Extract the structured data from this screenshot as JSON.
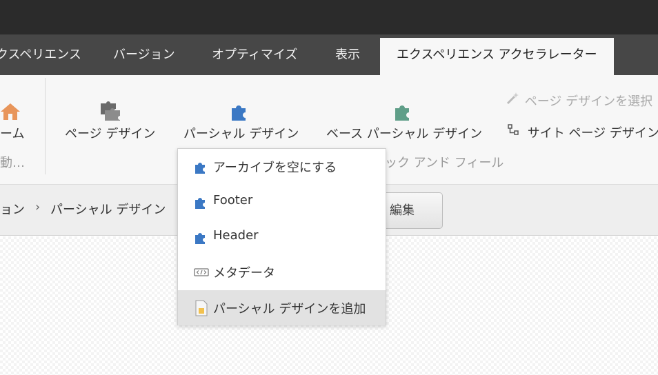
{
  "tabs": [
    {
      "label": "クスペリエンス"
    },
    {
      "label": "バージョン"
    },
    {
      "label": "オプティマイズ"
    },
    {
      "label": "表示"
    },
    {
      "label": "エクスペリエンス アクセラレーター",
      "active": true
    }
  ],
  "ribbon": {
    "home_label": "ーム",
    "home_sub": "動…",
    "page_design": "ページ デザイン",
    "partial_design": "パーシャル デザイン",
    "base_partial_design": "ベース パーシャル デザイン",
    "select_page_design": "ページ デザインを選択",
    "site_page_design": "サイト ページ デザイン",
    "look_and_feel": "ルック アンド フィール"
  },
  "breadcrumb": {
    "items": [
      "ョン",
      "パーシャル デザイン"
    ]
  },
  "edit_button": "編集",
  "dropdown": {
    "items": [
      {
        "label": "アーカイブを空にする",
        "icon": "puzzle-icon"
      },
      {
        "label": "Footer",
        "icon": "puzzle-icon"
      },
      {
        "label": "Header",
        "icon": "puzzle-icon"
      },
      {
        "label": "メタデータ",
        "icon": "code-icon"
      },
      {
        "label": "パーシャル デザインを追加",
        "icon": "add-document-icon"
      }
    ]
  },
  "colors": {
    "puzzle_blue": "#3b78c4",
    "puzzle_green": "#5f9e88",
    "topbar": "#2b2b2b",
    "tabbar": "#474747"
  }
}
